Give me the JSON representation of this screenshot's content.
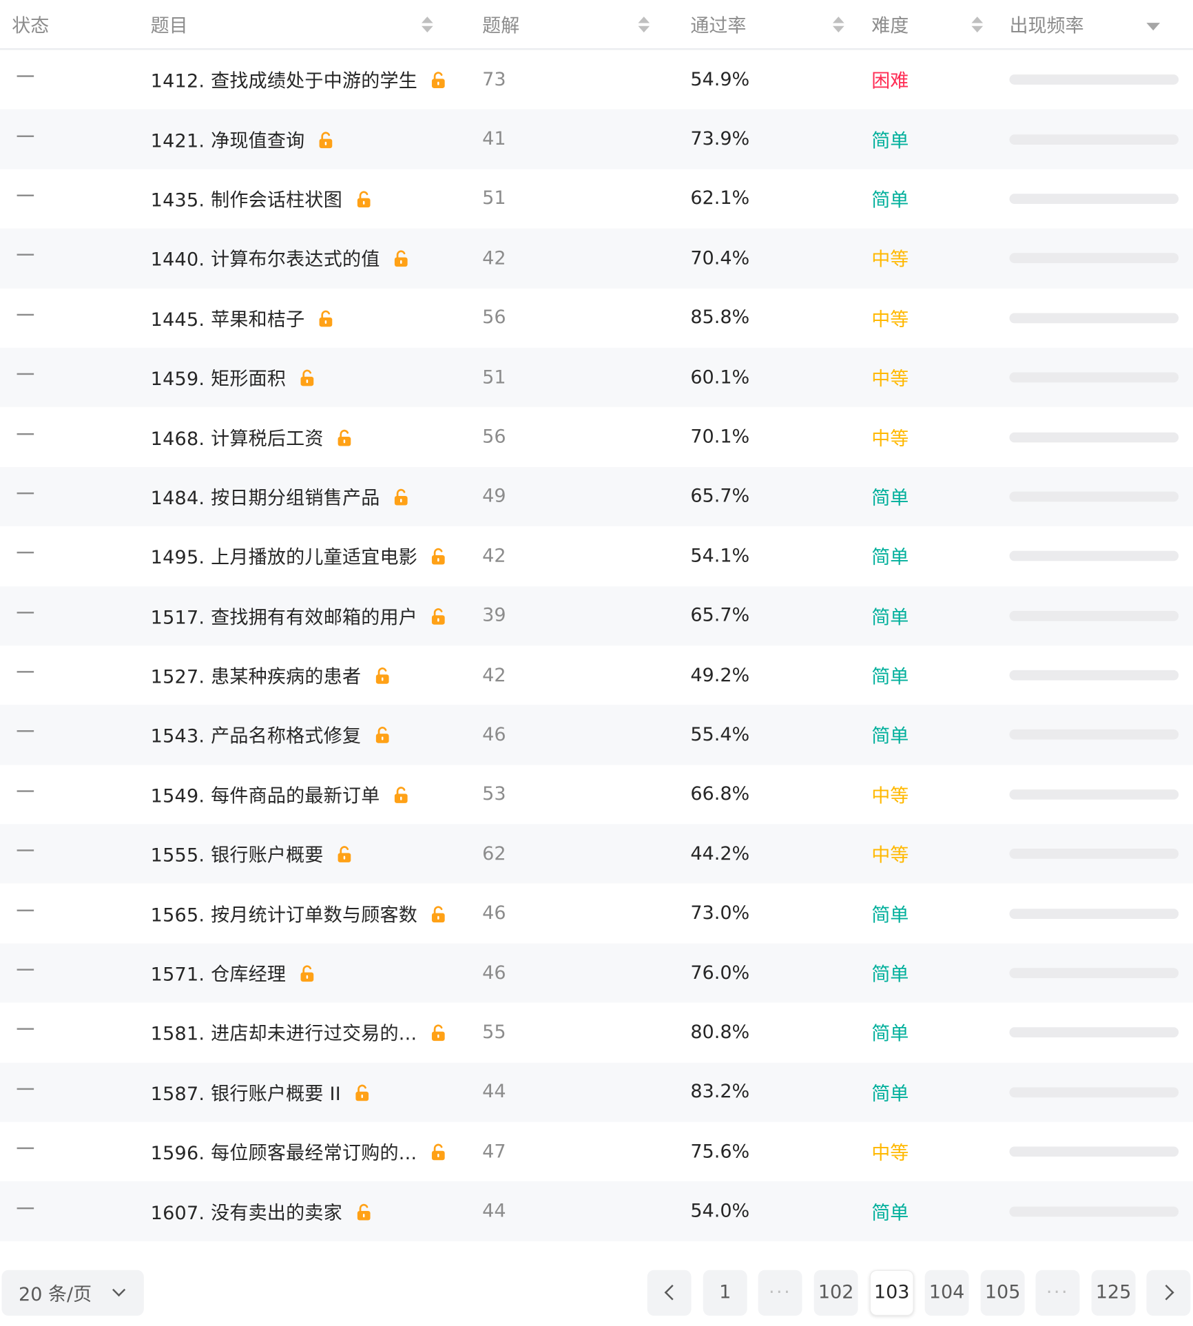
{
  "header": {
    "status": "状态",
    "title": "题目",
    "solutions": "题解",
    "pass_rate": "通过率",
    "difficulty": "难度",
    "frequency": "出现频率"
  },
  "colors": {
    "hard": "#ff2d55",
    "easy": "#00af9b",
    "medium": "#ffb800",
    "lock": "#ffa116"
  },
  "rows": [
    {
      "title": "1412. 查找成绩处于中游的学生",
      "solutions": "73",
      "rate": "54.9%",
      "difficulty": "困难",
      "level": "hard"
    },
    {
      "title": "1421. 净现值查询",
      "solutions": "41",
      "rate": "73.9%",
      "difficulty": "简单",
      "level": "easy"
    },
    {
      "title": "1435. 制作会话柱状图",
      "solutions": "51",
      "rate": "62.1%",
      "difficulty": "简单",
      "level": "easy"
    },
    {
      "title": "1440. 计算布尔表达式的值",
      "solutions": "42",
      "rate": "70.4%",
      "difficulty": "中等",
      "level": "medium"
    },
    {
      "title": "1445. 苹果和桔子",
      "solutions": "56",
      "rate": "85.8%",
      "difficulty": "中等",
      "level": "medium"
    },
    {
      "title": "1459. 矩形面积",
      "solutions": "51",
      "rate": "60.1%",
      "difficulty": "中等",
      "level": "medium"
    },
    {
      "title": "1468. 计算税后工资",
      "solutions": "56",
      "rate": "70.1%",
      "difficulty": "中等",
      "level": "medium"
    },
    {
      "title": "1484. 按日期分组销售产品",
      "solutions": "49",
      "rate": "65.7%",
      "difficulty": "简单",
      "level": "easy"
    },
    {
      "title": "1495. 上月播放的儿童适宜电影",
      "solutions": "42",
      "rate": "54.1%",
      "difficulty": "简单",
      "level": "easy"
    },
    {
      "title": "1517. 查找拥有有效邮箱的用户",
      "solutions": "39",
      "rate": "65.7%",
      "difficulty": "简单",
      "level": "easy"
    },
    {
      "title": "1527. 患某种疾病的患者",
      "solutions": "42",
      "rate": "49.2%",
      "difficulty": "简单",
      "level": "easy"
    },
    {
      "title": "1543. 产品名称格式修复",
      "solutions": "46",
      "rate": "55.4%",
      "difficulty": "简单",
      "level": "easy"
    },
    {
      "title": "1549. 每件商品的最新订单",
      "solutions": "53",
      "rate": "66.8%",
      "difficulty": "中等",
      "level": "medium"
    },
    {
      "title": "1555. 银行账户概要",
      "solutions": "62",
      "rate": "44.2%",
      "difficulty": "中等",
      "level": "medium"
    },
    {
      "title": "1565. 按月统计订单数与顾客数",
      "solutions": "46",
      "rate": "73.0%",
      "difficulty": "简单",
      "level": "easy"
    },
    {
      "title": "1571. 仓库经理",
      "solutions": "46",
      "rate": "76.0%",
      "difficulty": "简单",
      "level": "easy"
    },
    {
      "title": "1581. 进店却未进行过交易的...",
      "solutions": "55",
      "rate": "80.8%",
      "difficulty": "简单",
      "level": "easy"
    },
    {
      "title": "1587. 银行账户概要 II",
      "solutions": "44",
      "rate": "83.2%",
      "difficulty": "简单",
      "level": "easy"
    },
    {
      "title": "1596. 每位顾客最经常订购的...",
      "solutions": "47",
      "rate": "75.6%",
      "difficulty": "中等",
      "level": "medium"
    },
    {
      "title": "1607. 没有卖出的卖家",
      "solutions": "44",
      "rate": "54.0%",
      "difficulty": "简单",
      "level": "easy"
    }
  ],
  "pagination": {
    "page_size": "20 条/页",
    "pages": [
      {
        "label": "1",
        "kind": "page"
      },
      {
        "label": "···",
        "kind": "ellipsis"
      },
      {
        "label": "102",
        "kind": "page"
      },
      {
        "label": "103",
        "kind": "current"
      },
      {
        "label": "104",
        "kind": "page"
      },
      {
        "label": "105",
        "kind": "page"
      },
      {
        "label": "···",
        "kind": "ellipsis"
      },
      {
        "label": "125",
        "kind": "page"
      }
    ]
  }
}
